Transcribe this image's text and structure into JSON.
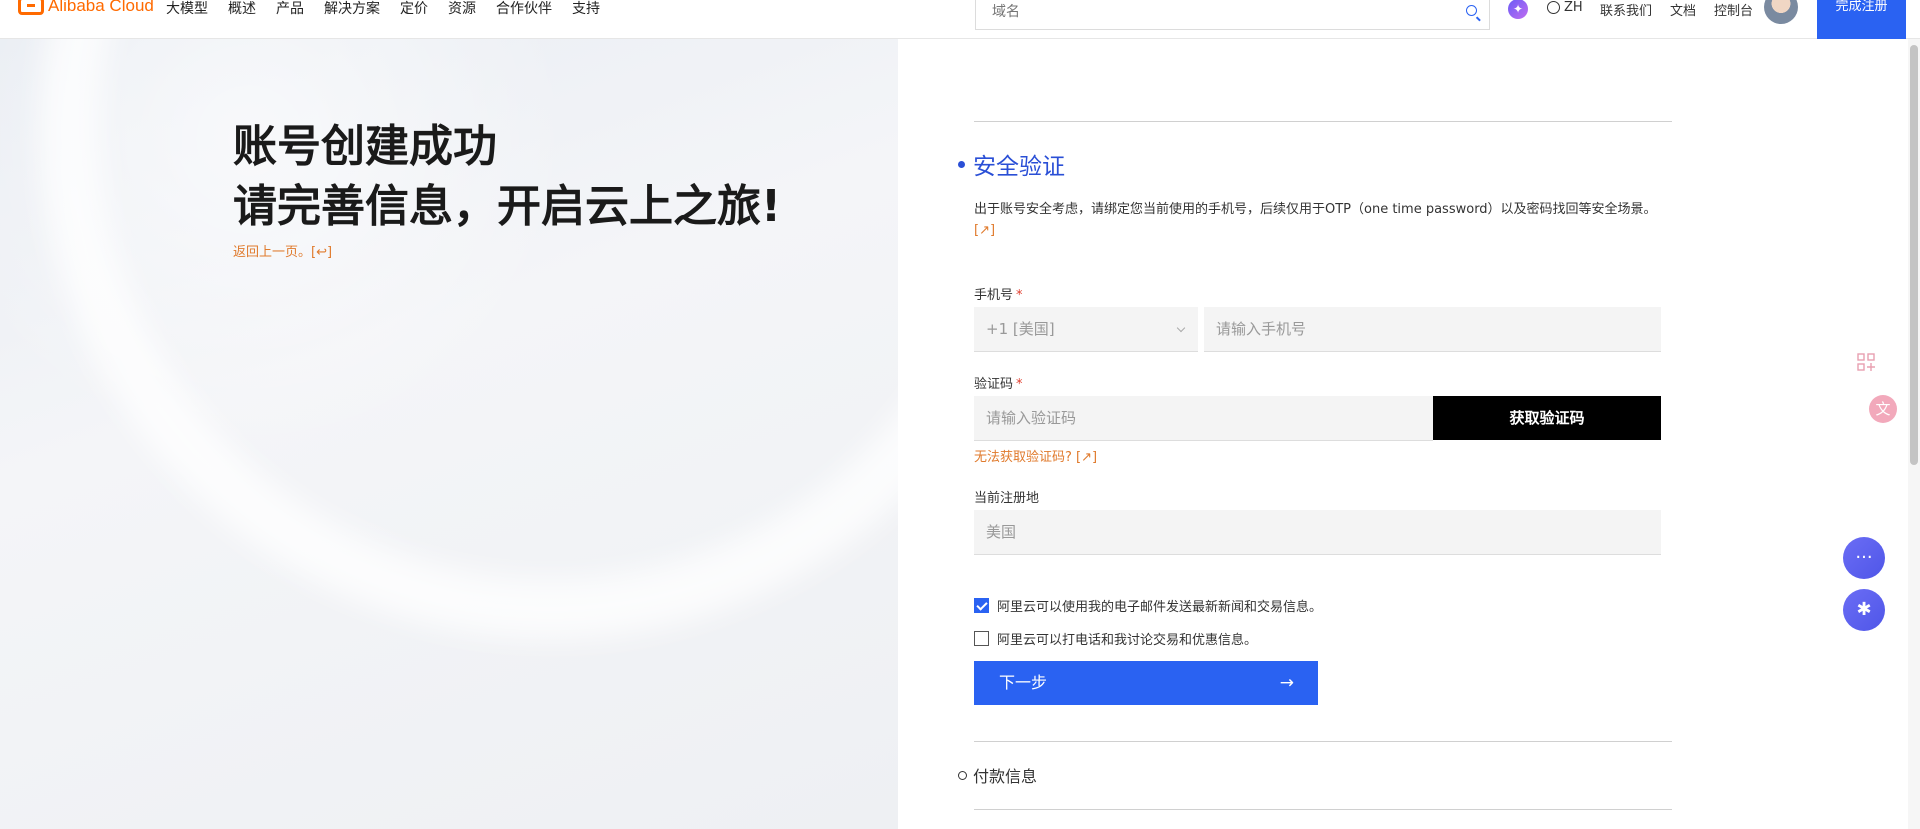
{
  "header": {
    "logo_text": "Alibaba Cloud",
    "nav": [
      "大模型",
      "概述",
      "产品",
      "解决方案",
      "定价",
      "资源",
      "合作伙伴",
      "支持"
    ],
    "search_placeholder": "域名",
    "lang": "ZH",
    "links": [
      "联系我们",
      "文档",
      "控制台"
    ],
    "finish_label": "完成注册"
  },
  "hero": {
    "title_line1": "账号创建成功",
    "title_line2": "请完善信息，开启云上之旅!",
    "back_link": "返回上一页。[↩]"
  },
  "form": {
    "step1_title": "安全验证",
    "description": "出于账号安全考虑，请绑定您当前使用的手机号，后续仅用于OTP（one time password）以及密码找回等安全场景。",
    "description_link": "[↗]",
    "phone_label": "手机号",
    "required_mark": "*",
    "country_code": "+1 [美国]",
    "phone_placeholder": "请输入手机号",
    "code_label": "验证码",
    "code_placeholder": "请输入验证码",
    "get_code_label": "获取验证码",
    "help_link": "无法获取验证码? [↗]",
    "region_label": "当前注册地",
    "region_value": "美国",
    "consent_email": "阿里云可以使用我的电子邮件发送最新新闻和交易信息。",
    "consent_email_checked": true,
    "consent_phone": "阿里云可以打电话和我讨论交易和优惠信息。",
    "consent_phone_checked": false,
    "next_label": "下一步",
    "next_arrow": "→",
    "step2_title": "付款信息"
  },
  "colors": {
    "brand": "#ff6a00",
    "primary": "#2a62f2",
    "step_title": "#2a4fd6",
    "link": "#e07a2c"
  }
}
